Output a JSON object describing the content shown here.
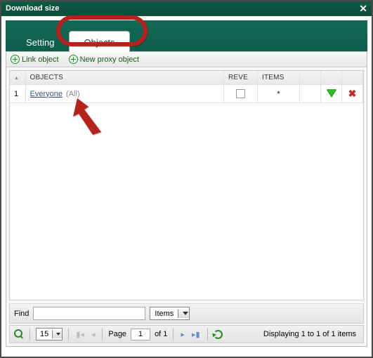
{
  "window": {
    "title": "Download size"
  },
  "tabs": {
    "setting": "Setting",
    "objects": "Objects"
  },
  "toolbar": {
    "link_object": "Link object",
    "new_proxy": "New proxy object"
  },
  "grid": {
    "headers": {
      "objects": "OBJECTS",
      "reve": "REVE",
      "items": "ITEMS"
    },
    "rows": [
      {
        "num": "1",
        "name": "Everyone",
        "suffix": "(All)",
        "reve_checked": false,
        "items": "*"
      }
    ]
  },
  "find": {
    "label": "Find",
    "value": "",
    "scope": "Items"
  },
  "pager": {
    "page_size": "15",
    "page_label_pre": "Page",
    "page_value": "1",
    "page_label_post": "of 1",
    "display": "Displaying 1 to 1 of 1 items"
  }
}
